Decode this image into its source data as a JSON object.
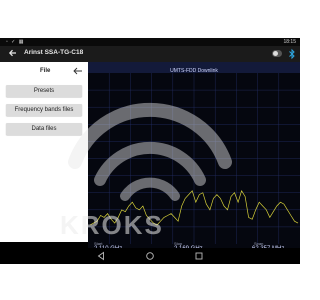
{
  "status_bar": {
    "left_icons": "▫ ✓ ▦",
    "time": "18:15"
  },
  "app_bar": {
    "title": "Arinst SSA-TG-C18"
  },
  "drawer": {
    "title": "File",
    "buttons": [
      {
        "label": "Presets"
      },
      {
        "label": "Frequency bands files"
      },
      {
        "label": "Data files"
      }
    ]
  },
  "chart": {
    "title": "UMTS-FDD Downlink",
    "footer": {
      "start_label": "Start",
      "start": "2.110 GHz",
      "stop_label": "Stop",
      "stop": "2.169 GHz",
      "span_label": "Span",
      "span": "62.357 MHz"
    }
  },
  "chart_data": {
    "type": "line",
    "series": [
      {
        "values": [
          -100,
          -99,
          -98,
          -95,
          -96,
          -94,
          -97,
          -99,
          -96,
          -92,
          -93,
          -90,
          -88,
          -91,
          -92,
          -90,
          -95,
          -97,
          -99,
          -100,
          -98,
          -96,
          -95,
          -94,
          -96,
          -98,
          -90,
          -86,
          -84,
          -82,
          -88,
          -84,
          -83,
          -89,
          -92,
          -86,
          -84,
          -86,
          -90,
          -92,
          -85,
          -83,
          -88,
          -82,
          -85,
          -96,
          -97,
          -92,
          -88,
          -90,
          -92,
          -96,
          -93,
          -90,
          -88,
          -89,
          -92,
          -95,
          -98,
          -99
        ]
      }
    ],
    "grid": true,
    "colors": {
      "trace": "#d8d23a",
      "grid": "#243068",
      "header": "#131a3a"
    }
  }
}
